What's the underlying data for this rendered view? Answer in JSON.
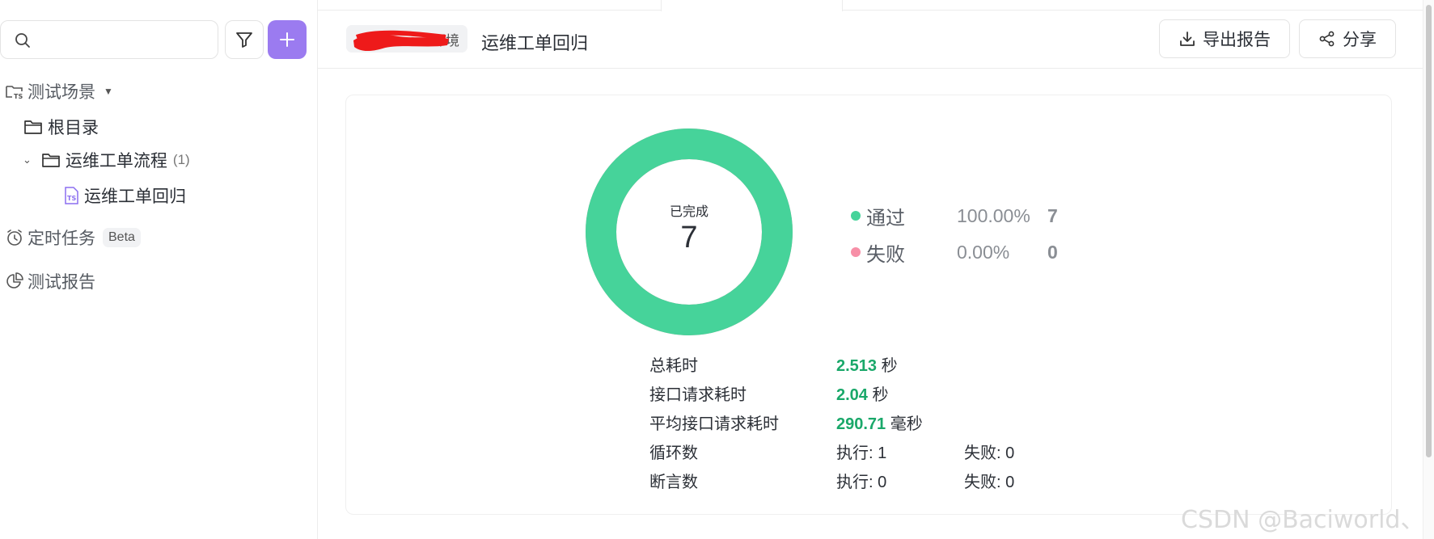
{
  "sidebar": {
    "search": {
      "placeholder": "",
      "value": ""
    },
    "tree": {
      "section_label": "测试场景",
      "root_label": "根目录",
      "folder_label": "运维工单流程",
      "folder_count": "(1)",
      "case_label": "运维工单回归"
    },
    "scheduled": {
      "label": "定时任务",
      "badge": "Beta"
    },
    "reports": {
      "label": "测试报告"
    }
  },
  "header": {
    "env_tag": "环境",
    "title": "运维工单回归",
    "export_label": "导出报告",
    "share_label": "分享"
  },
  "summary": {
    "donut_label": "已完成",
    "donut_value": "7",
    "pass_fraction": 1.0,
    "legend": [
      {
        "name": "通过",
        "percent": "100.00%",
        "count": "7",
        "color": "#46d39a"
      },
      {
        "name": "失败",
        "percent": "0.00%",
        "count": "0",
        "color": "#f78fa7"
      }
    ]
  },
  "stats": {
    "total_time": {
      "label": "总耗时",
      "value": "2.513",
      "unit": "秒"
    },
    "request_time": {
      "label": "接口请求耗时",
      "value": "2.04",
      "unit": "秒"
    },
    "avg_request_time": {
      "label": "平均接口请求耗时",
      "value": "290.71",
      "unit": "毫秒"
    },
    "loops": {
      "label": "循环数",
      "executed": "执行: 1",
      "failed": "失败: 0"
    },
    "assertions": {
      "label": "断言数",
      "executed": "执行: 0",
      "failed": "失败: 0"
    }
  },
  "colors": {
    "accent": "#9b7bf0",
    "pass": "#46d39a",
    "fail": "#f78fa7",
    "value_green": "#1aa86a"
  },
  "watermark": "CSDN @Baciworld、"
}
